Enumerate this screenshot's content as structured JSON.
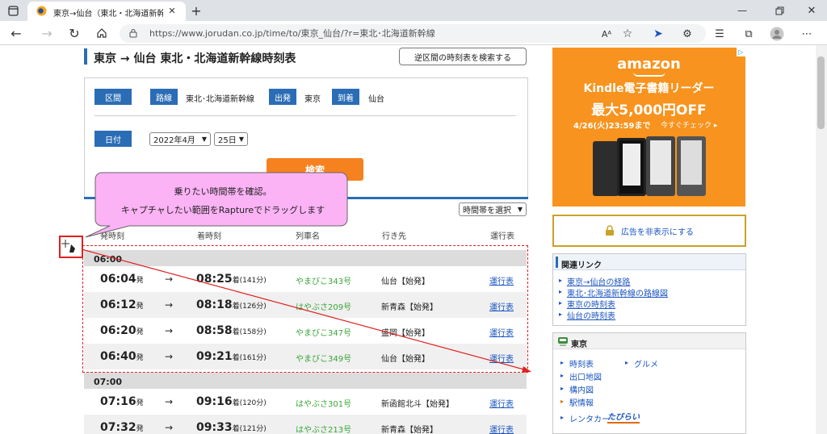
{
  "browser": {
    "tab_title": "東京→仙台（東北・北海道新幹線",
    "url": "https://www.jorudan.co.jp/time/to/東京_仙台/?r=東北･北海道新幹線"
  },
  "header": {
    "title": "東京 → 仙台 東北・北海道新幹線時刻表",
    "reverse_button": "逆区間の時刻表を検索する"
  },
  "search": {
    "section_label": "区間",
    "route_label": "路線",
    "route_value": "東北･北海道新幹線",
    "dep_label": "出発",
    "dep_value": "東京",
    "arr_label": "到着",
    "arr_value": "仙台",
    "date_label": "日付",
    "month_value": "2022年4月",
    "day_value": "25日",
    "search_button": "検索"
  },
  "callout": {
    "line1": "乗りたい時間帯を確認。",
    "line2": "キャプチャしたい範囲をRaptureでドラッグします"
  },
  "table": {
    "time_select": "時間帯を選択",
    "headers": [
      "発時刻",
      "着時刻",
      "列車名",
      "行き先",
      "運行表"
    ],
    "hours": [
      "06:00",
      "07:00"
    ],
    "rows": [
      {
        "dep": "06:04",
        "dep_suffix": "発",
        "arrow": "→",
        "arr": "08:25",
        "arr_suffix": "着(141分)",
        "train": "やまびこ343号",
        "dest": "仙台【始発】",
        "link": "運行表"
      },
      {
        "dep": "06:12",
        "dep_suffix": "発",
        "arrow": "→",
        "arr": "08:18",
        "arr_suffix": "着(126分)",
        "train": "はやぶさ209号",
        "dest": "新青森【始発】",
        "link": "運行表"
      },
      {
        "dep": "06:20",
        "dep_suffix": "発",
        "arrow": "→",
        "arr": "08:58",
        "arr_suffix": "着(158分)",
        "train": "やまびこ347号",
        "dest": "盛岡【始発】",
        "link": "運行表"
      },
      {
        "dep": "06:40",
        "dep_suffix": "発",
        "arrow": "→",
        "arr": "09:21",
        "arr_suffix": "着(161分)",
        "train": "やまびこ349号",
        "dest": "仙台【始発】",
        "link": "運行表"
      },
      {
        "dep": "07:16",
        "dep_suffix": "発",
        "arrow": "→",
        "arr": "09:16",
        "arr_suffix": "着(120分)",
        "train": "はやぶさ301号",
        "dest": "新函館北斗【始発】",
        "link": "運行表"
      },
      {
        "dep": "07:32",
        "dep_suffix": "発",
        "arrow": "→",
        "arr": "09:33",
        "arr_suffix": "着(121分)",
        "train": "はやぶさ213号",
        "dest": "新青森【始発】",
        "link": "運行表"
      }
    ]
  },
  "ad": {
    "brand": "amazon",
    "line1": "Kindle電子書籍リーダー",
    "line2": "最大5,000円OFF",
    "line3": "4/26(火)23:59まで",
    "cta": "今すぐチェック ▸"
  },
  "hide_ad": "広告を非表示にする",
  "related": {
    "title": "関連リンク",
    "links": [
      "東京→仙台の経路",
      "東北･北海道新幹線の路線図",
      "東京の時刻表",
      "仙台の時刻表"
    ]
  },
  "station": {
    "title": "東京",
    "links": [
      "時刻表",
      "グルメ",
      "出口地図",
      "構内図",
      "駅情報",
      "レンタカー"
    ],
    "rental_logo": "たびらい"
  },
  "colors": {
    "accent": "#2b6db5",
    "ad_orange": "#f7931e",
    "callout": "#fbb3f5",
    "selection": "#e02020"
  }
}
